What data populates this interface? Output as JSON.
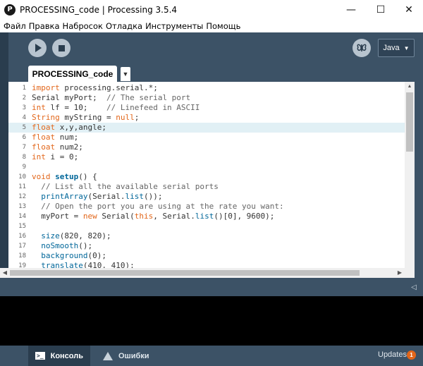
{
  "window": {
    "title": "PROCESSING_code | Processing 3.5.4",
    "app_icon_glyph": "P",
    "minimize_glyph": "—",
    "maximize_glyph": "☐",
    "close_glyph": "✕"
  },
  "menu": [
    "Файл",
    "Правка",
    "Набросок",
    "Отладка",
    "Инструменты",
    "Помощь"
  ],
  "toolbar": {
    "run_icon": "play-icon",
    "stop_icon": "stop-icon",
    "debug_icon": "butterfly-icon",
    "mode_label": "Java",
    "mode_caret": "▼"
  },
  "tab": {
    "label": "PROCESSING_code",
    "menu_glyph": "▼"
  },
  "editor": {
    "active_line": 5,
    "lines": [
      {
        "n": "1",
        "tokens": [
          [
            "kw",
            "import"
          ],
          [
            "",
            " processing.serial.*;"
          ]
        ]
      },
      {
        "n": "2",
        "tokens": [
          [
            "",
            "Serial myPort;  "
          ],
          [
            "cm",
            "// The serial port"
          ]
        ]
      },
      {
        "n": "3",
        "tokens": [
          [
            "kw",
            "int"
          ],
          [
            "",
            " lf = 10;    "
          ],
          [
            "cm",
            "// Linefeed in ASCII"
          ]
        ]
      },
      {
        "n": "4",
        "tokens": [
          [
            "kw",
            "String"
          ],
          [
            "",
            " myString = "
          ],
          [
            "kw",
            "null"
          ],
          [
            "",
            ";"
          ]
        ]
      },
      {
        "n": "5",
        "tokens": [
          [
            "kw",
            "float"
          ],
          [
            "",
            " x,y,angle;"
          ]
        ]
      },
      {
        "n": "6",
        "tokens": [
          [
            "kw",
            "float"
          ],
          [
            "",
            " num;"
          ]
        ]
      },
      {
        "n": "7",
        "tokens": [
          [
            "kw",
            "float"
          ],
          [
            "",
            " num2;"
          ]
        ]
      },
      {
        "n": "8",
        "tokens": [
          [
            "kw",
            "int"
          ],
          [
            "",
            " i = 0;"
          ]
        ]
      },
      {
        "n": "9",
        "tokens": []
      },
      {
        "n": "10",
        "tokens": [
          [
            "kw",
            "void"
          ],
          [
            "",
            " "
          ],
          [
            "fnb",
            "setup"
          ],
          [
            "",
            "() {"
          ]
        ]
      },
      {
        "n": "11",
        "tokens": [
          [
            "",
            "  "
          ],
          [
            "cm",
            "// List all the available serial ports"
          ]
        ]
      },
      {
        "n": "12",
        "tokens": [
          [
            "",
            "  "
          ],
          [
            "fn",
            "printArray"
          ],
          [
            "",
            "(Serial."
          ],
          [
            "fn",
            "list"
          ],
          [
            "",
            "());"
          ]
        ]
      },
      {
        "n": "13",
        "tokens": [
          [
            "",
            "  "
          ],
          [
            "cm",
            "// Open the port you are using at the rate you want:"
          ]
        ]
      },
      {
        "n": "14",
        "tokens": [
          [
            "",
            "  myPort = "
          ],
          [
            "kw",
            "new"
          ],
          [
            "",
            " Serial("
          ],
          [
            "kw",
            "this"
          ],
          [
            "",
            ", Serial."
          ],
          [
            "fn",
            "list"
          ],
          [
            "",
            "()[0], 9600);"
          ]
        ]
      },
      {
        "n": "15",
        "tokens": []
      },
      {
        "n": "16",
        "tokens": [
          [
            "",
            "  "
          ],
          [
            "fn",
            "size"
          ],
          [
            "",
            "(820, 820);"
          ]
        ]
      },
      {
        "n": "17",
        "tokens": [
          [
            "",
            "  "
          ],
          [
            "fn",
            "noSmooth"
          ],
          [
            "",
            "();"
          ]
        ]
      },
      {
        "n": "18",
        "tokens": [
          [
            "",
            "  "
          ],
          [
            "fn",
            "background"
          ],
          [
            "",
            "(0);"
          ]
        ]
      },
      {
        "n": "19",
        "tokens": [
          [
            "",
            "  "
          ],
          [
            "fn",
            "translate"
          ],
          [
            "",
            "(410, 410);"
          ]
        ]
      }
    ]
  },
  "scroll": {
    "left_arrow": "◀",
    "right_arrow": "▶",
    "up_arrow": "▲"
  },
  "message_bar": {
    "collapse_glyph": "◁"
  },
  "footer": {
    "console_label": "Консоль",
    "console_glyph": ">_",
    "errors_label": "Ошибки",
    "updates_label": "Updates",
    "updates_count": "1"
  },
  "colors": {
    "toolbar_bg": "#3c5266",
    "keyword": "#e2661a",
    "function": "#006699",
    "comment": "#666666",
    "active_line": "#e1f0f5",
    "badge": "#e2661a"
  }
}
